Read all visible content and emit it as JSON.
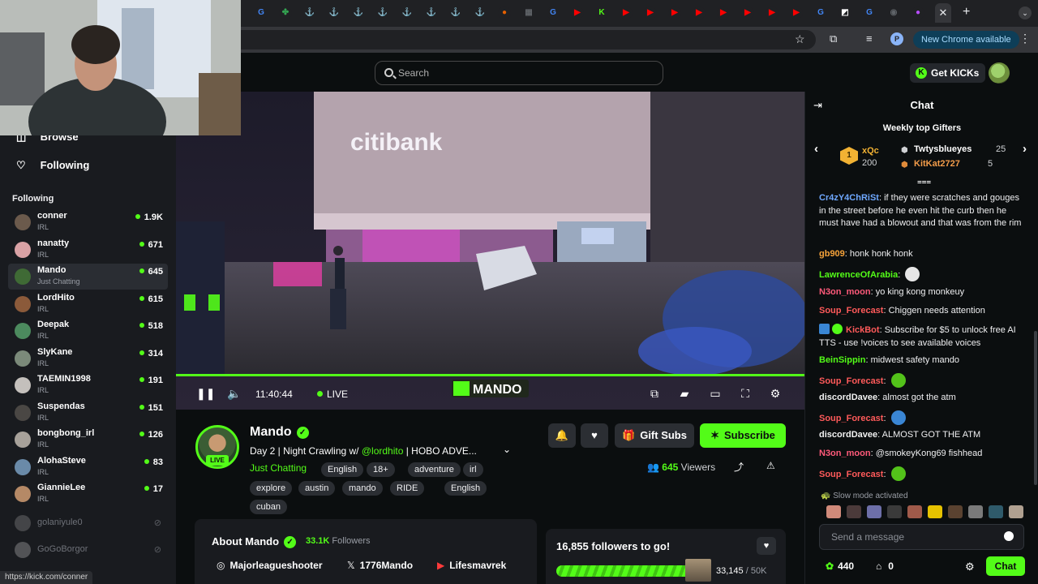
{
  "browser": {
    "new_chrome_label": "New Chrome available",
    "profile_initial": "P",
    "tabs": [
      {
        "icon": "google-icon",
        "color": "#4285f4",
        "glyph": "G"
      },
      {
        "icon": "clover-icon",
        "color": "#34a853",
        "glyph": "✤"
      },
      {
        "icon": "pin-icon",
        "color": "#5f6368",
        "glyph": "⚓"
      },
      {
        "icon": "pin-icon",
        "color": "#5f6368",
        "glyph": "⚓"
      },
      {
        "icon": "pin-icon",
        "color": "#5f6368",
        "glyph": "⚓"
      },
      {
        "icon": "pin-icon",
        "color": "#5f6368",
        "glyph": "⚓"
      },
      {
        "icon": "pin-icon",
        "color": "#5f6368",
        "glyph": "⚓"
      },
      {
        "icon": "pin-icon",
        "color": "#5f6368",
        "glyph": "⚓"
      },
      {
        "icon": "pin-icon",
        "color": "#5f6368",
        "glyph": "⚓"
      },
      {
        "icon": "pin-icon",
        "color": "#5f6368",
        "glyph": "⚓"
      },
      {
        "icon": "firefox-icon",
        "color": "#e66000",
        "glyph": "●"
      },
      {
        "icon": "calculator-icon",
        "color": "#5f6368",
        "glyph": "▦"
      },
      {
        "icon": "google-icon",
        "color": "#4285f4",
        "glyph": "G"
      },
      {
        "icon": "youtube-icon",
        "color": "#ff0000",
        "glyph": "▶"
      },
      {
        "icon": "kick-icon",
        "color": "#53fc18",
        "glyph": "K"
      },
      {
        "icon": "youtube-icon",
        "color": "#ff0000",
        "glyph": "▶"
      },
      {
        "icon": "youtube-icon",
        "color": "#ff0000",
        "glyph": "▶"
      },
      {
        "icon": "youtube-icon",
        "color": "#ff0000",
        "glyph": "▶"
      },
      {
        "icon": "youtube-icon",
        "color": "#ff0000",
        "glyph": "▶"
      },
      {
        "icon": "youtube-icon",
        "color": "#ff0000",
        "glyph": "▶"
      },
      {
        "icon": "youtube-icon",
        "color": "#ff0000",
        "glyph": "▶"
      },
      {
        "icon": "youtube-icon",
        "color": "#ff0000",
        "glyph": "▶"
      },
      {
        "icon": "youtube-icon",
        "color": "#ff0000",
        "glyph": "▶"
      },
      {
        "icon": "google-icon",
        "color": "#4285f4",
        "glyph": "G"
      },
      {
        "icon": "notion-icon",
        "color": "#ffffff",
        "glyph": "◩"
      },
      {
        "icon": "google-icon",
        "color": "#4285f4",
        "glyph": "G"
      },
      {
        "icon": "record-icon",
        "color": "#5f6368",
        "glyph": "◉"
      },
      {
        "icon": "colorwheel-icon",
        "color": "#b84dff",
        "glyph": "●"
      }
    ]
  },
  "header": {
    "search_placeholder": "Search",
    "get_kicks_label": "Get KICKs"
  },
  "sidebar": {
    "browse_label": "Browse",
    "following_nav_label": "Following",
    "following_section_label": "Following",
    "channels": [
      {
        "name": "conner",
        "category": "IRL",
        "viewers": "1.9K",
        "avatar": "#6b5a4c"
      },
      {
        "name": "nanatty",
        "category": "IRL",
        "viewers": "671",
        "avatar": "#d9a2a5"
      },
      {
        "name": "Mando",
        "category": "Just Chatting",
        "viewers": "645",
        "avatar": "#3f6a35"
      },
      {
        "name": "LordHito",
        "category": "IRL",
        "viewers": "615",
        "avatar": "#8b5a3a"
      },
      {
        "name": "Deepak",
        "category": "IRL",
        "viewers": "518",
        "avatar": "#4c8a5e"
      },
      {
        "name": "SlyKane",
        "category": "IRL",
        "viewers": "314",
        "avatar": "#7b8a7a"
      },
      {
        "name": "TAEMIN1998",
        "category": "IRL",
        "viewers": "191",
        "avatar": "#c4c0bc"
      },
      {
        "name": "Suspendas",
        "category": "IRL",
        "viewers": "151",
        "avatar": "#4a4744"
      },
      {
        "name": "bongbong_irl",
        "category": "IRL",
        "viewers": "126",
        "avatar": "#a7a19a"
      },
      {
        "name": "AlohaSteve",
        "category": "IRL",
        "viewers": "83",
        "avatar": "#6a8aa8"
      },
      {
        "name": "GiannieLee",
        "category": "IRL",
        "viewers": "17",
        "avatar": "#b58966"
      }
    ],
    "offline_channels": [
      {
        "name": "golaniyule0",
        "avatar": "#7a7a7a"
      },
      {
        "name": "GoGoBorgor",
        "avatar": "#9a9a9a"
      }
    ]
  },
  "status_bar": {
    "url": "https://kick.com/conner"
  },
  "video": {
    "time": "11:40:44",
    "live_label": "LIVE",
    "watermark": "MANDO",
    "sign_text": "citibank"
  },
  "stream": {
    "streamer_name": "Mando",
    "live_badge": "LIVE",
    "title_prefix": "Day 2 | Night Crawling w/ ",
    "title_mention": "@lordhito",
    "title_suffix": " |  HOBO ADVE...",
    "category": "Just Chatting",
    "tags": [
      "English",
      "18+",
      "adventure",
      "irl",
      "explore",
      "austin",
      "mando",
      "RIDE",
      "English",
      "cuban"
    ],
    "gift_subs_label": "Gift Subs",
    "subscribe_label": "Subscribe",
    "viewer_count": "645",
    "viewers_label": "Viewers"
  },
  "about": {
    "title": "About Mando",
    "followers_count": "33.1K",
    "followers_label": "Followers",
    "socials": [
      {
        "icon": "instagram-icon",
        "glyph": "◎",
        "label": "Majorleagueshooter"
      },
      {
        "icon": "x-icon",
        "glyph": "𝕏",
        "label": "1776Mando"
      },
      {
        "icon": "youtube-icon",
        "glyph": "▶",
        "label": "Lifesmavrek"
      }
    ]
  },
  "goal": {
    "text": "16,855 followers to go!",
    "current": "33,145",
    "target": "/ 50K",
    "progress_fraction": 0.663
  },
  "chat": {
    "title": "Chat",
    "gifters_title": "Weekly top Gifters",
    "gifters": [
      {
        "rank": "1",
        "name": "xQc",
        "count": "200",
        "color": "#f2b233"
      },
      {
        "name": "Twtysblueyes",
        "count": "25",
        "color": "#ffffff"
      },
      {
        "name": "KitKat2727",
        "count": "5",
        "color": "#f39c4a"
      }
    ],
    "messages": [
      {
        "user": "Cr4zY4ChRiSt",
        "color": "#6fa8ff",
        "text": "if they were scratches and gouges in the street before he even hit the curb then he must have had a blowout and that was from the rim"
      },
      {
        "user": "gb909",
        "color": "#f7a33a",
        "text": "honk honk honk"
      },
      {
        "user": "LawrenceOfArabia",
        "color": "#53fc18",
        "text": "",
        "emote": "skull-emote",
        "emote_color": "#e6e6e6"
      },
      {
        "user": "N3on_moon",
        "color": "#ff5a7a",
        "text": "yo king kong monkeuy"
      },
      {
        "user": "Soup_Forecast",
        "color": "#ff5a5a",
        "text": "Chiggen needs attention"
      },
      {
        "user": "KickBot",
        "color": "#ff5a5a",
        "text": "Subscribe for $5 to unlock free AI TTS - use !voices to see available voices",
        "bot": true
      },
      {
        "user": "BeinSippin",
        "color": "#53fc18",
        "text": "midwest safety mando"
      },
      {
        "user": "Soup_Forecast",
        "color": "#ff5a5a",
        "text": "",
        "emote": "frog-emote",
        "emote_color": "#53c21a"
      },
      {
        "user": "discordDavee",
        "color": "#f2f2f2",
        "text": "almost got the atm"
      },
      {
        "user": "Soup_Forecast",
        "color": "#ff5a5a",
        "text": "",
        "emote": "earth-emote",
        "emote_color": "#3a86d4"
      },
      {
        "user": "discordDavee",
        "color": "#f2f2f2",
        "text": "ALMOST GOT THE ATM"
      },
      {
        "user": "N3on_moon",
        "color": "#ff5a7a",
        "text": "@smokeyKong69 fishhead"
      },
      {
        "user": "Soup_Forecast",
        "color": "#ff5a5a",
        "text": "",
        "emote": "frog-emote",
        "emote_color": "#53c21a"
      }
    ],
    "slow_mode_text": "Slow mode activated",
    "input_placeholder": "Send a message",
    "points": "440",
    "store_count": "0",
    "send_label": "Chat"
  }
}
